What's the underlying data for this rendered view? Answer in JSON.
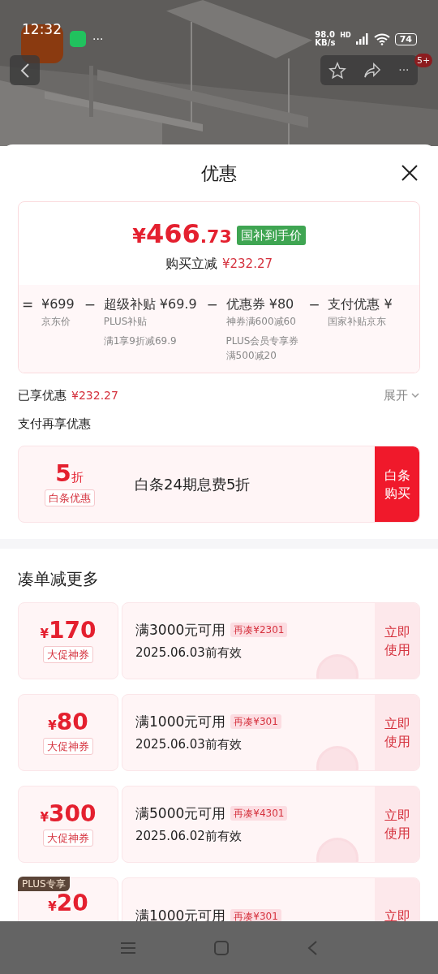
{
  "status_bar": {
    "time": "12:32",
    "more": "···",
    "speed_value": "98.0",
    "speed_unit": "KB/s",
    "network": "HD",
    "battery": "74"
  },
  "top_nav": {
    "more": "···",
    "badge": "5+"
  },
  "sheet": {
    "title": "优惠"
  },
  "price_card": {
    "currency": "¥",
    "integer": "466",
    "decimal": ".73",
    "tag": "国补到手价",
    "saving_label": "购买立减",
    "saving_value": "¥232.27",
    "breakdown": [
      {
        "operator": "=",
        "title": "¥699",
        "notes": [
          "京东价"
        ]
      },
      {
        "operator": "−",
        "title": "超级补贴 ¥69.9",
        "notes": [
          "PLUS补贴",
          "满1享9折减69.9"
        ]
      },
      {
        "operator": "−",
        "title": "优惠券 ¥80",
        "notes": [
          "神券满600减60",
          "PLUS会员专享券",
          "满500减20"
        ]
      },
      {
        "operator": "−",
        "title": "支付优惠 ¥",
        "notes": [
          "国家补贴京东"
        ]
      }
    ]
  },
  "enjoyed": {
    "label": "已享优惠",
    "value": "¥232.27",
    "toggle": "展开",
    "expanded": false
  },
  "pay_section": {
    "title": "支付再享优惠",
    "discount_value": "5",
    "discount_unit": "折",
    "discount_tag": "白条优惠",
    "description": "白条24期息费5折",
    "action": [
      "白条",
      "购买"
    ]
  },
  "more_section": {
    "title": "凑单减更多",
    "coupons": [
      {
        "currency": "¥",
        "amount": "170",
        "tag": "大促神券",
        "condition": "满3000元可用",
        "gap": "再凑¥2301",
        "expiry": "2025.06.03前有效",
        "action": [
          "立即",
          "使用"
        ]
      },
      {
        "currency": "¥",
        "amount": "80",
        "tag": "大促神券",
        "condition": "满1000元可用",
        "gap": "再凑¥301",
        "expiry": "2025.06.03前有效",
        "action": [
          "立即",
          "使用"
        ]
      },
      {
        "currency": "¥",
        "amount": "300",
        "tag": "大促神券",
        "condition": "满5000元可用",
        "gap": "再凑¥4301",
        "expiry": "2025.06.02前有效",
        "action": [
          "立即",
          "使用"
        ]
      },
      {
        "plus_badge": "PLUS专享",
        "currency": "¥",
        "amount": "20",
        "condition": "满1000元可用",
        "gap": "再凑¥301",
        "action": [
          "立即"
        ]
      }
    ]
  }
}
